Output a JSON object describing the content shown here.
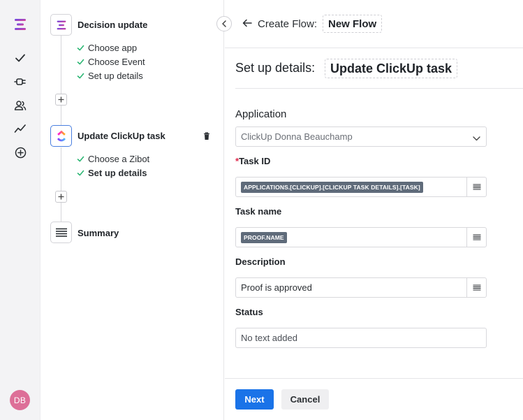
{
  "user": {
    "initials": "DB"
  },
  "rail": {
    "items": [
      {
        "icon": "app-logo-icon"
      },
      {
        "icon": "check-icon"
      },
      {
        "icon": "plug-icon"
      },
      {
        "icon": "users-icon"
      },
      {
        "icon": "activity-icon"
      },
      {
        "icon": "add-circle-icon"
      }
    ]
  },
  "steps": [
    {
      "title": "Decision update",
      "icon": "app-logo-icon",
      "substeps": [
        "Choose app",
        "Choose Event",
        "Set up details"
      ]
    },
    {
      "title": "Update ClickUp task",
      "icon": "clickup-icon",
      "active": true,
      "substeps": [
        "Choose a Zibot",
        "Set up details"
      ]
    },
    {
      "title": "Summary",
      "icon": "list-icon"
    }
  ],
  "header": {
    "create_label": "Create Flow:",
    "flow_name": "New Flow"
  },
  "details": {
    "label": "Set up details:",
    "name": "Update ClickUp task"
  },
  "form": {
    "application": {
      "label": "Application",
      "value": "ClickUp Donna Beauchamp"
    },
    "task_id": {
      "required_mark": "*",
      "label": "Task ID",
      "tag": "APPLICATIONS.[CLICKUP].[CLICKUP TASK DETAILS].[TASK]"
    },
    "task_name": {
      "label": "Task name",
      "tag": "PROOF.NAME"
    },
    "description": {
      "label": "Description",
      "value": "Proof is approved"
    },
    "status": {
      "label": "Status",
      "placeholder": "No text added"
    }
  },
  "footer": {
    "next_label": "Next",
    "cancel_label": "Cancel"
  },
  "colors": {
    "accent": "#1a73e8",
    "check": "#2bb673",
    "required": "#e0284b",
    "avatar": "#dd6f98"
  }
}
